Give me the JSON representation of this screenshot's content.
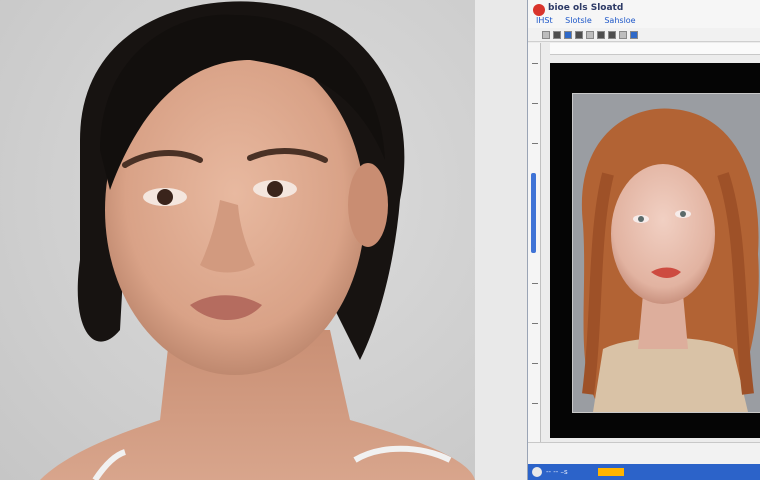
{
  "app": {
    "title": "bioe ols Sloatd",
    "menu": [
      "IHSt",
      "Slotsle",
      "Sahsloe"
    ],
    "toolbar_icons": [
      "document-icon",
      "open-icon",
      "save-icon",
      "image-icon",
      "layers-icon",
      "brush-icon",
      "text-icon",
      "crop-icon",
      "zoom-icon"
    ],
    "status_text": "",
    "taskbar_text": "-- -- –s"
  },
  "colors": {
    "taskbar": "#2c63c9",
    "canvas": "#050505",
    "menu_text": "#1d57c8"
  }
}
